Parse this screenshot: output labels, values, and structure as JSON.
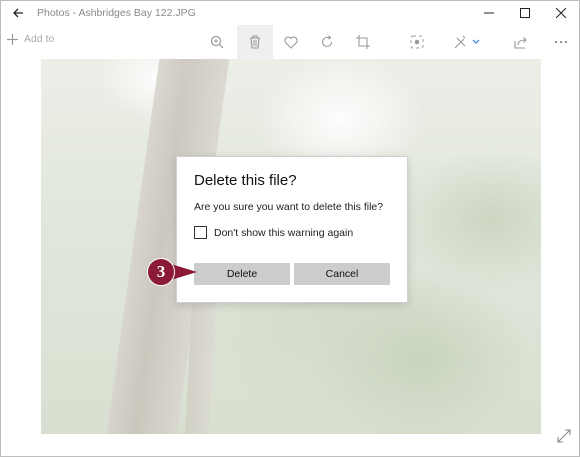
{
  "window": {
    "title": "Photos - Ashbridges Bay 122.JPG"
  },
  "toolbar": {
    "add_to_label": "Add to",
    "icons": [
      "zoom-icon",
      "trash-icon",
      "heart-icon",
      "rotate-icon",
      "crop-icon",
      "enhance-icon",
      "edit-icon",
      "share-icon",
      "more-icon"
    ]
  },
  "dialog": {
    "title": "Delete this file?",
    "message": "Are you sure you want to delete this file?",
    "checkbox_label": "Don't show this warning again",
    "checkbox_checked": false,
    "delete_label": "Delete",
    "cancel_label": "Cancel"
  },
  "callout": {
    "number": "3",
    "color": "#8b1a36"
  }
}
